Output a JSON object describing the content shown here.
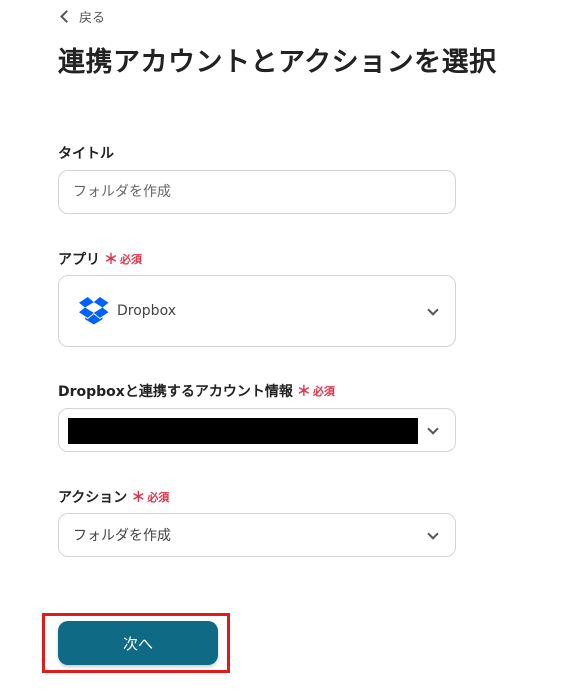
{
  "back": {
    "label": "戻る"
  },
  "page_title": "連携アカウントとアクションを選択",
  "colors": {
    "required": "#e0344b",
    "button_bg": "#0e6a85",
    "button_text": "#ffffff",
    "highlight": "#e11a1a",
    "dropbox_blue": "#0061fe"
  },
  "fields": {
    "title": {
      "label": "タイトル",
      "value": "",
      "placeholder": "フォルダを作成"
    },
    "app": {
      "label": "アプリ",
      "required_mark": "＊",
      "required_text": "必須",
      "selected": "Dropbox",
      "icon": "dropbox-logo"
    },
    "account": {
      "label": "Dropboxと連携するアカウント情報",
      "required_mark": "＊",
      "required_text": "必須",
      "value_redacted": true
    },
    "action": {
      "label": "アクション",
      "required_mark": "＊",
      "required_text": "必須",
      "selected": "フォルダを作成"
    }
  },
  "next_button": {
    "label": "次へ"
  }
}
